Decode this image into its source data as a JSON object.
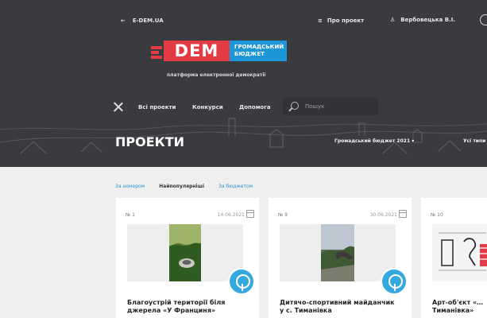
{
  "header": {
    "back_label": "E-DEM.UA",
    "about_label": "Про проект",
    "user_name": "Вербовецька В.І."
  },
  "logo": {
    "main": "DEM",
    "sub_line1": "ГРОМАДСЬКИЙ",
    "sub_line2": "БЮДЖЕТ",
    "tagline": "платформа електронної демократії",
    "colors": {
      "red": "#e23b44",
      "blue": "#1d96d8"
    }
  },
  "nav": {
    "items": [
      "Всі проекти",
      "Конкурси",
      "Допомога"
    ],
    "search_placeholder": "Пошук"
  },
  "page": {
    "title": "ПРОЕКТИ",
    "filter_budget": "Громадський бюджет 2021",
    "filter_type": "Усі типи"
  },
  "sort": {
    "by_number": "За номером",
    "popular": "Найпопулярніші",
    "by_budget": "За бюджетом"
  },
  "cards": [
    {
      "number": "№ 1",
      "date": "14.06.2021",
      "title": "Благоустрій території біля джерела «У Франциня»"
    },
    {
      "number": "№ 9",
      "date": "30.06.2021",
      "title": "Дитячо-спортивний майданчик у с. Тиманівка"
    },
    {
      "number": "№ 10",
      "date": "",
      "title": "Арт-об'єкт «… Тиманівка»"
    }
  ]
}
